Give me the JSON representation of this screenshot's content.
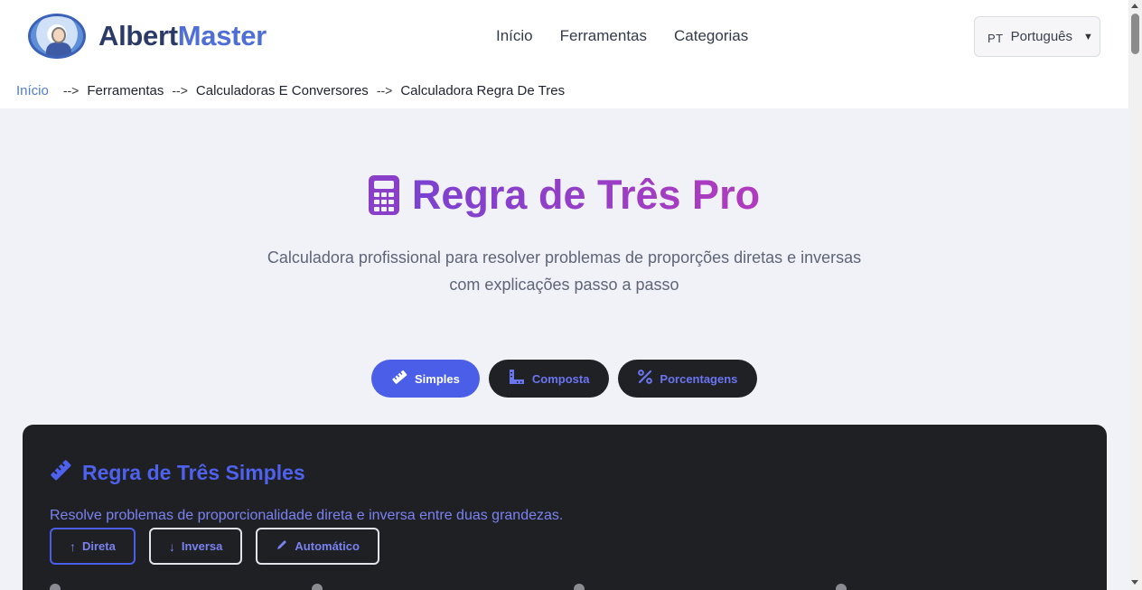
{
  "brand": {
    "name_part1": "Albert",
    "name_part2": "Master"
  },
  "nav": [
    {
      "label": "Início"
    },
    {
      "label": "Ferramentas"
    },
    {
      "label": "Categorias"
    }
  ],
  "language": {
    "code": "PT",
    "label": "Português",
    "caret": "▼"
  },
  "breadcrumb": {
    "items": [
      "Início",
      "Ferramentas",
      "Calculadoras E Conversores",
      "Calculadora Regra De Tres"
    ],
    "separator": "-->"
  },
  "hero": {
    "title": "Regra de Três Pro",
    "subtitle_line1": "Calculadora profissional para resolver problemas de proporções diretas e inversas",
    "subtitle_line2": "com explicações passo a passo"
  },
  "tabs": [
    {
      "label": "Simples",
      "icon": "ruler-icon",
      "active": true
    },
    {
      "label": "Composta",
      "icon": "ruler-combined-icon",
      "active": false
    },
    {
      "label": "Porcentagens",
      "icon": "percent-icon",
      "active": false
    }
  ],
  "card": {
    "title": "Regra de Três Simples",
    "description": "Resolve problemas de proporcionalidade direta e inversa entre duas grandezas.",
    "modes": [
      {
        "label": "Direta",
        "icon": "arrow-up-icon",
        "active": true
      },
      {
        "label": "Inversa",
        "icon": "arrow-down-icon",
        "active": false
      },
      {
        "label": "Automático",
        "icon": "pencil-icon",
        "active": false
      }
    ]
  },
  "colors": {
    "accent": "#4a5ee8",
    "title_gradient_start": "#7a42d0",
    "title_gradient_end": "#b23bbd",
    "card_bg": "#1f2023"
  }
}
